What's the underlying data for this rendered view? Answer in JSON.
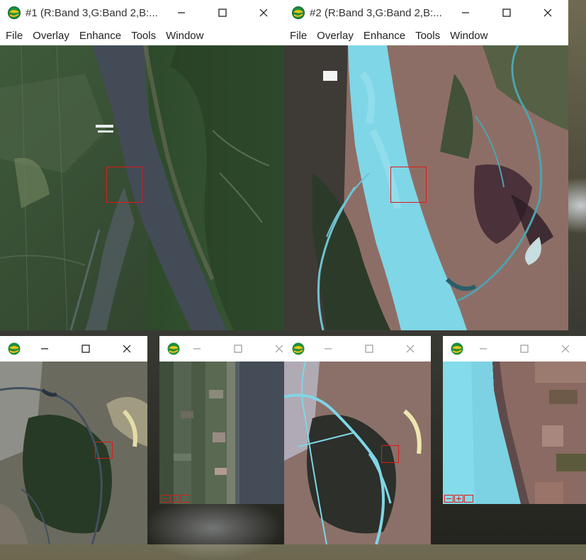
{
  "windows": {
    "w1": {
      "title": "#1 (R:Band 3,G:Band 2,B:...",
      "menu": [
        "File",
        "Overlay",
        "Enhance",
        "Tools",
        "Window"
      ],
      "controls": [
        "minimize",
        "maximize",
        "close"
      ]
    },
    "w2": {
      "title": "#2 (R:Band 3,G:Band 2,B:...",
      "menu": [
        "File",
        "Overlay",
        "Enhance",
        "Tools",
        "Window"
      ],
      "controls": [
        "minimize",
        "maximize",
        "close"
      ]
    },
    "scroll1": {
      "title": "",
      "controls": [
        "minimize",
        "maximize",
        "close"
      ]
    },
    "zoom1": {
      "title": "",
      "controls": [
        "minimize",
        "maximize",
        "close"
      ],
      "tools": [
        "zoom-out",
        "zoom-in",
        "zoom-reset"
      ]
    },
    "scroll2": {
      "title": "",
      "controls": [
        "minimize",
        "maximize",
        "close"
      ]
    },
    "zoom2": {
      "title": "",
      "controls": [
        "minimize",
        "maximize",
        "close"
      ],
      "tools": [
        "zoom-out",
        "zoom-in",
        "zoom-reset"
      ]
    }
  },
  "colors": {
    "roi_box": "#e01818",
    "river_truecolor": "#4a5260",
    "river_falsecolor": "#7fd6e6",
    "vegetation": "#2f4a2c",
    "bare_soil": "#9a7a6e"
  },
  "icons": {
    "app": "envi-globe-icon",
    "minimize": "minimize-icon",
    "maximize": "maximize-icon",
    "close": "close-icon"
  }
}
